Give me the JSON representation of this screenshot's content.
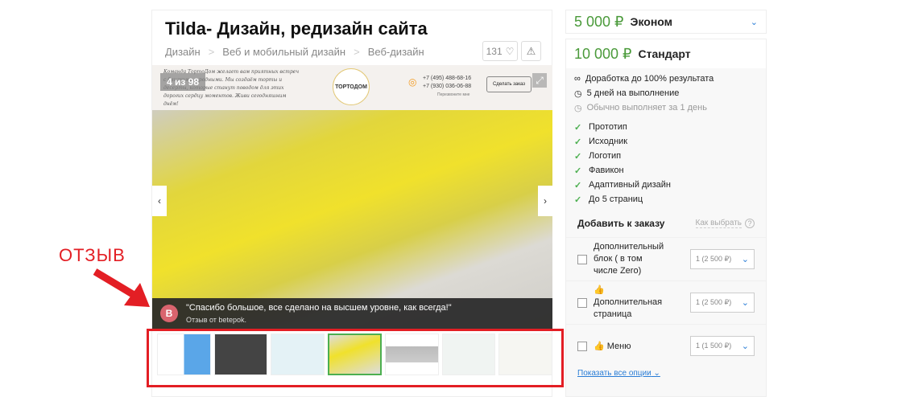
{
  "title": "Tilda- Дизайн, редизайн сайта",
  "breadcrumbs": [
    "Дизайн",
    "Веб и мобильный дизайн",
    "Веб-дизайн"
  ],
  "likes": "131",
  "gallery": {
    "counter": "4 из 98",
    "header_text": "Команда ТортоДом желает вам приятных встреч с близкими и родными. Мы создаём торты и десерты, которые станут поводом для этих дорогих сердцу моментов. Живи сегодняшним днём!",
    "logo": "ТОРТОДОМ",
    "phone1": "+7 (495) 488-68-16",
    "phone2": "+7 (930) 036-06-88",
    "callback": "Перезвоните мне",
    "order_btn": "Сделать заказ"
  },
  "review": {
    "avatar": "B",
    "text": "\"Спасибо большое, все сделано на высшем уровне, как всегда!\"",
    "author": "Отзыв от betepok."
  },
  "annotation": "ОТЗЫВ",
  "annotation_color": "#e31e24",
  "plans": {
    "econom": {
      "price": "5 000 ₽",
      "name": "Эконом"
    },
    "standard": {
      "price": "10 000 ₽",
      "name": "Стандарт"
    }
  },
  "info": [
    "Доработка до 100% результата",
    "5 дней на выполнение",
    "Обычно выполняет за 1 день"
  ],
  "features": [
    "Прототип",
    "Исходник",
    "Логотип",
    "Фавикон",
    "Адаптивный дизайн",
    "До 5 страниц"
  ],
  "addons": {
    "title": "Добавить к заказу",
    "how": "Как выбрать",
    "items": [
      {
        "label": "Дополнительный блок ( в том числе Zero)",
        "value": "1 (2 500 ₽)"
      },
      {
        "label": "Дополнительная страница",
        "value": "1 (2 500 ₽)"
      },
      {
        "label": "Меню",
        "value": "1 (1 500 ₽)"
      }
    ],
    "show_all": "Показать все опции"
  }
}
